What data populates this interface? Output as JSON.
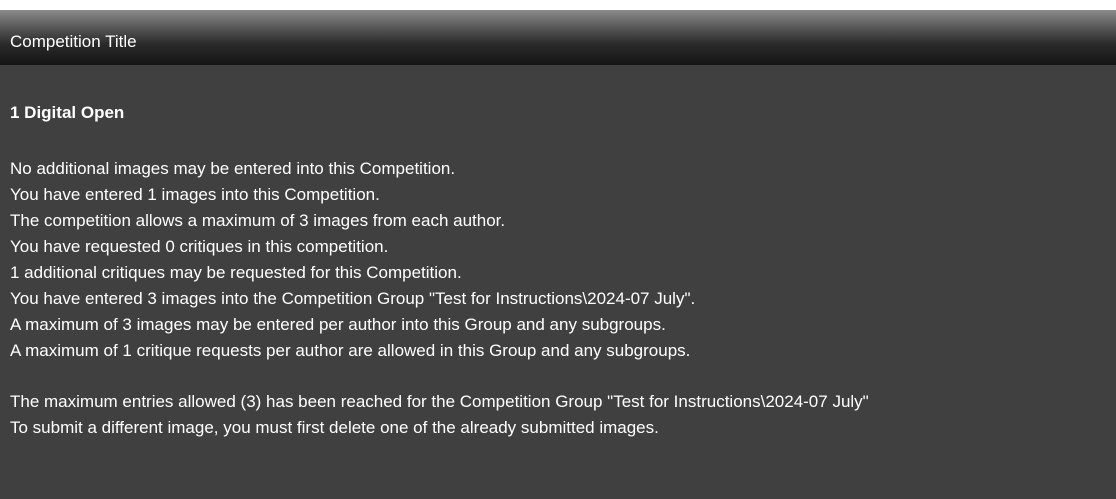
{
  "header": {
    "title": "Competition Title"
  },
  "competition": {
    "name": "1 Digital Open"
  },
  "info_lines": [
    "No additional images may be entered into this Competition.",
    "You have entered 1 images into this Competition.",
    "The competition allows a maximum of 3 images from each author.",
    "You have requested 0 critiques in this competition.",
    "1 additional critiques may be requested for this Competition.",
    "You have entered 3 images into the Competition Group \"Test for Instructions\\2024-07 July\".",
    "A maximum of 3 images may be entered per author into this Group and any subgroups.",
    "A maximum of 1 critique requests per author are allowed in this Group and any subgroups."
  ],
  "limit_lines": [
    "The maximum entries allowed (3) has been reached for the Competition Group \"Test for Instructions\\2024-07 July\"",
    "To submit a different image, you must first delete one of the already submitted images."
  ],
  "colors": {
    "panel_background": "#404040",
    "text": "#ffffff"
  }
}
